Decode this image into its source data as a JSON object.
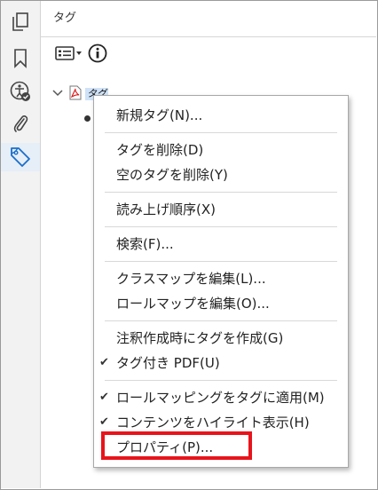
{
  "panel": {
    "title": "タグ"
  },
  "tree": {
    "root_label": "タグ"
  },
  "menu": {
    "items": [
      {
        "label": "新規タグ(N)...",
        "checked": false
      },
      {
        "label": "タグを削除(D)",
        "checked": false
      },
      {
        "label": "空のタグを削除(Y)",
        "checked": false
      },
      {
        "label": "読み上げ順序(X)",
        "checked": false
      },
      {
        "label": "検索(F)...",
        "checked": false
      },
      {
        "label": "クラスマップを編集(L)...",
        "checked": false
      },
      {
        "label": "ロールマップを編集(O)...",
        "checked": false
      },
      {
        "label": "注釈作成時にタグを作成(G)",
        "checked": false
      },
      {
        "label": "タグ付き PDF(U)",
        "checked": true
      },
      {
        "label": "ロールマッピングをタグに適用(M)",
        "checked": true
      },
      {
        "label": "コンテンツをハイライト表示(H)",
        "checked": true
      },
      {
        "label": "プロパティ(P)...",
        "checked": false
      }
    ],
    "check_glyph": "✔"
  },
  "icons": {
    "leftbar": [
      "pages-icon",
      "bookmark-icon",
      "accessibility-icon",
      "attachment-icon",
      "tag-icon"
    ],
    "toolbar": [
      "options-menu-icon",
      "info-icon"
    ],
    "tree": [
      "chevron-down-icon",
      "pdf-file-icon"
    ]
  },
  "colors": {
    "highlight": "#e8141b",
    "active_icon": "#1a6fc9",
    "selection": "#cfe2f7"
  }
}
